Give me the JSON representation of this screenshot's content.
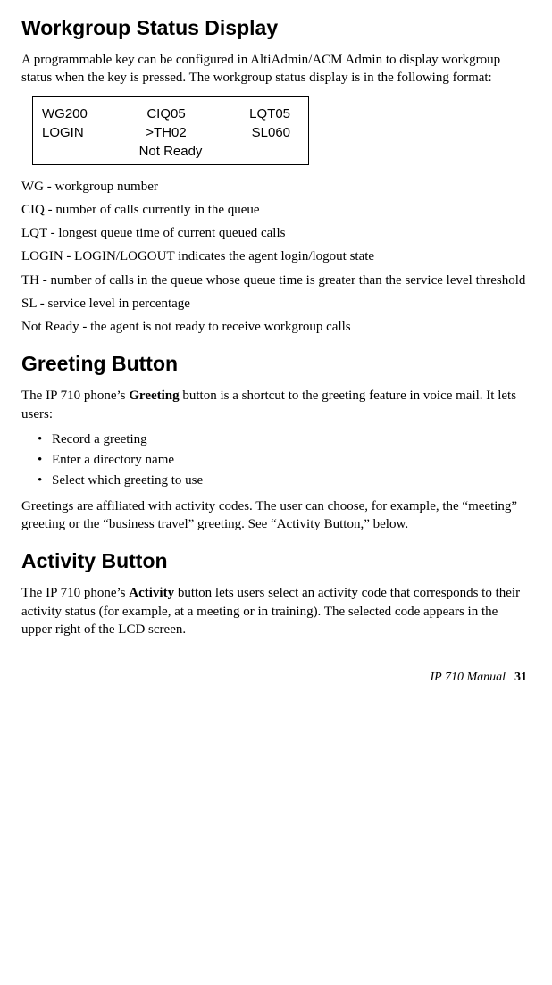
{
  "section1": {
    "title": "Workgroup Status Display",
    "intro": "A programmable key can be configured in AltiAdmin/ACM Admin to display workgroup status when the key is pressed. The workgroup status display is in the following format:",
    "status_box": {
      "row1": {
        "c1": "WG200",
        "c2": "CIQ05",
        "c3": "LQT05"
      },
      "row2": {
        "c1": "LOGIN",
        "c2": ">TH02",
        "c3": "SL060"
      },
      "row3": "Not Ready"
    },
    "defs": {
      "d1": "WG - workgroup number",
      "d2": "CIQ - number of calls currently in the queue",
      "d3": "LQT - longest queue time of current queued calls",
      "d4": "LOGIN - LOGIN/LOGOUT indicates the agent login/logout state",
      "d5": "TH - number of calls in the queue whose queue time is greater than the service level threshold",
      "d6": "SL - service level in percentage",
      "d7": "Not Ready - the agent is not ready to receive workgroup calls"
    }
  },
  "section2": {
    "title": "Greeting Button",
    "intro_pre": "The IP 710 phone’s ",
    "intro_bold": "Greeting",
    "intro_post": " button is a shortcut to the greeting feature in voice mail. It lets users:",
    "bullets": {
      "b1": "Record a greeting",
      "b2": "Enter a directory name",
      "b3": "Select which greeting to use"
    },
    "outro": "Greetings are affiliated with activity codes. The user can choose, for example, the “meeting” greeting or the “business travel” greeting. See “Activity Button,” below."
  },
  "section3": {
    "title": "Activity Button",
    "intro_pre": "The IP 710 phone’s ",
    "intro_bold": "Activity",
    "intro_post": " button lets users select an activity code that corresponds to their activity status (for example, at a meeting or in training). The selected code appears in the upper right of the LCD screen."
  },
  "footer": {
    "manual": "IP 710 Manual",
    "page": "31"
  }
}
